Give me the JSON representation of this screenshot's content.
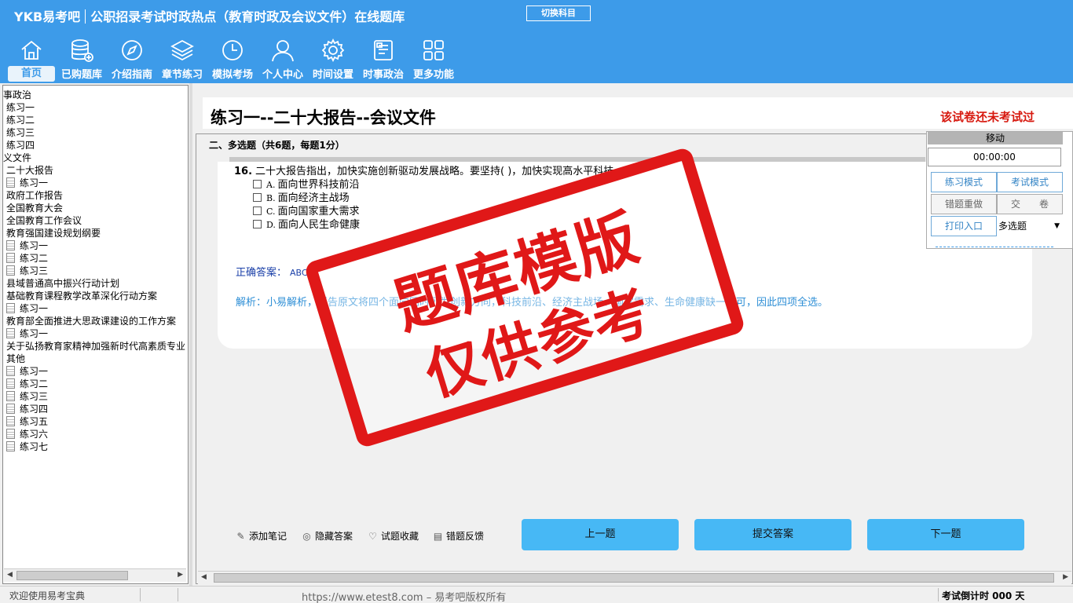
{
  "header": {
    "brand": "YKB易考吧",
    "title": "公职招录考试时政热点（教育时政及会议文件）在线题库",
    "switch_subject": "切换科目"
  },
  "nav": [
    {
      "label": "首页",
      "icon": "home-icon"
    },
    {
      "label": "已购题库",
      "icon": "database-icon"
    },
    {
      "label": "介绍指南",
      "icon": "compass-icon"
    },
    {
      "label": "章节练习",
      "icon": "layers-icon"
    },
    {
      "label": "模拟考场",
      "icon": "clock-icon"
    },
    {
      "label": "个人中心",
      "icon": "user-icon"
    },
    {
      "label": "时间设置",
      "icon": "gear-icon"
    },
    {
      "label": "时事政治",
      "icon": "document-icon"
    },
    {
      "label": "更多功能",
      "icon": "grid-icon"
    }
  ],
  "tree": [
    {
      "label": "事政治",
      "indent": 0,
      "icon": false
    },
    {
      "label": "练习一",
      "indent": 1,
      "icon": false
    },
    {
      "label": "练习二",
      "indent": 1,
      "icon": false
    },
    {
      "label": "练习三",
      "indent": 1,
      "icon": false
    },
    {
      "label": "练习四",
      "indent": 1,
      "icon": false
    },
    {
      "label": "义文件",
      "indent": 0,
      "icon": false
    },
    {
      "label": "二十大报告",
      "indent": 1,
      "icon": false
    },
    {
      "label": "练习一",
      "indent": 1,
      "icon": true
    },
    {
      "label": "政府工作报告",
      "indent": 1,
      "icon": false
    },
    {
      "label": "全国教育大会",
      "indent": 1,
      "icon": false
    },
    {
      "label": "全国教育工作会议",
      "indent": 1,
      "icon": false
    },
    {
      "label": "教育强国建设规划纲要",
      "indent": 1,
      "icon": false
    },
    {
      "label": "练习一",
      "indent": 1,
      "icon": true
    },
    {
      "label": "练习二",
      "indent": 1,
      "icon": true
    },
    {
      "label": "练习三",
      "indent": 1,
      "icon": true
    },
    {
      "label": "县域普通高中振兴行动计划",
      "indent": 1,
      "icon": false
    },
    {
      "label": "基础教育课程教学改革深化行动方案",
      "indent": 1,
      "icon": false
    },
    {
      "label": "练习一",
      "indent": 1,
      "icon": true
    },
    {
      "label": "教育部全面推进大思政课建设的工作方案",
      "indent": 1,
      "icon": false
    },
    {
      "label": "练习一",
      "indent": 1,
      "icon": true
    },
    {
      "label": "关于弘扬教育家精神加强新时代高素质专业",
      "indent": 1,
      "icon": false
    },
    {
      "label": "其他",
      "indent": 1,
      "icon": false
    },
    {
      "label": "练习一",
      "indent": 1,
      "icon": true
    },
    {
      "label": "练习二",
      "indent": 1,
      "icon": true
    },
    {
      "label": "练习三",
      "indent": 1,
      "icon": true
    },
    {
      "label": "练习四",
      "indent": 1,
      "icon": true
    },
    {
      "label": "练习五",
      "indent": 1,
      "icon": true
    },
    {
      "label": "练习六",
      "indent": 1,
      "icon": true
    },
    {
      "label": "练习七",
      "indent": 1,
      "icon": true
    }
  ],
  "paper": {
    "title": "练习一--二十大报告--会议文件",
    "status": "该试卷还未考试过",
    "section": "二、多选题（共6题，每题1分）"
  },
  "question": {
    "number": "16.",
    "text": "二十大报告指出，加快实施创新驱动发展战略。要坚持( )，加快实现高水平科技",
    "options": [
      {
        "key": "A.",
        "text": "面向世界科技前沿"
      },
      {
        "key": "B.",
        "text": "面向经济主战场"
      },
      {
        "key": "C.",
        "text": "面向国家重大需求"
      },
      {
        "key": "D.",
        "text": "面向人民生命健康"
      }
    ],
    "answer_label": "正确答案：",
    "answer_value": "ABCD",
    "analysis": "解析：小易解析，报告原文将四个面向同时列为创新方向，科技前沿、经济主战场、国家需求、生命健康缺一不可，因此四项全选。"
  },
  "tools": [
    {
      "label": "添加笔记",
      "icon": "pencil-icon"
    },
    {
      "label": "隐藏答案",
      "icon": "eye-icon"
    },
    {
      "label": "试题收藏",
      "icon": "heart-icon"
    },
    {
      "label": "错题反馈",
      "icon": "feedback-icon"
    }
  ],
  "buttons": {
    "prev": "上一题",
    "submit": "提交答案",
    "next": "下一题"
  },
  "control": {
    "move": "移动",
    "timer": "00:00:00",
    "practice_mode": "练习模式",
    "exam_mode": "考试模式",
    "redo_wrong": "错题重做",
    "hand_in": "交　　卷",
    "print": "打印入口",
    "type_select": "多选题"
  },
  "status": {
    "welcome": "欢迎使用易考宝典",
    "url": "https://www.etest8.com – 易考吧版权所有",
    "countdown": "考试倒计时 000 天"
  },
  "watermark": {
    "line1": "题库模版",
    "line2": "仅供参考"
  },
  "colors": {
    "header": "#3d9be9",
    "button": "#47b8f5",
    "stamp": "#e01818",
    "status_red": "#d7190f"
  }
}
